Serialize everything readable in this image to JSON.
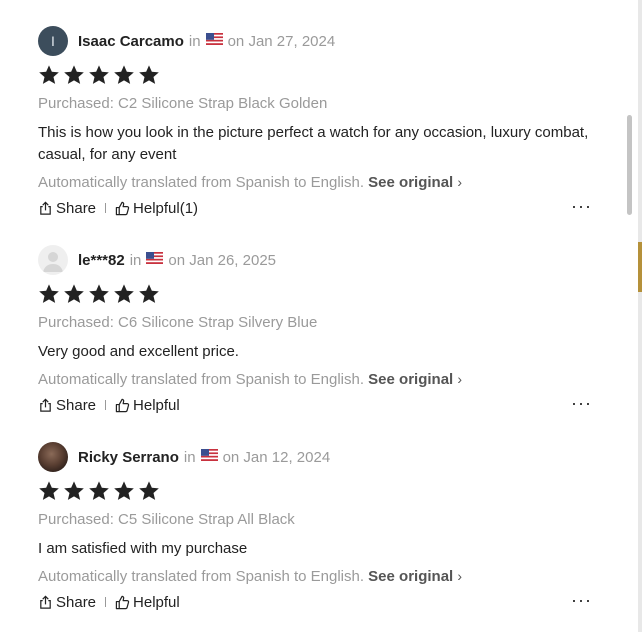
{
  "reviews": [
    {
      "avatar_letter": "I",
      "avatar_type": "letter",
      "name": "Isaac Carcamo",
      "in_label": "in",
      "date": "on Jan 27, 2024",
      "country_flag": "us-flag-icon",
      "rating": 5,
      "purchased": "Purchased: C2 Silicone Strap Black Golden",
      "text": "This is how you look in the picture perfect a watch for any occasion, luxury combat, casual, for any event",
      "translated_note": "Automatically translated from Spanish to English.",
      "see_original": "See original",
      "share": "Share",
      "helpful": "Helpful(1)"
    },
    {
      "avatar_letter": "",
      "avatar_type": "generic",
      "name": "le***82",
      "in_label": "in",
      "date": "on Jan 26, 2025",
      "country_flag": "us-flag-icon",
      "rating": 5,
      "purchased": "Purchased: C6 Silicone Strap Silvery Blue",
      "text": "Very good and excellent price.",
      "translated_note": "Automatically translated from Spanish to English.",
      "see_original": "See original",
      "share": "Share",
      "helpful": "Helpful"
    },
    {
      "avatar_letter": "",
      "avatar_type": "photo",
      "name": "Ricky Serrano",
      "in_label": "in",
      "date": "on Jan 12, 2024",
      "country_flag": "us-flag-icon",
      "rating": 5,
      "purchased": "Purchased: C5 Silicone Strap All Black",
      "text": "I am satisfied with my purchase",
      "translated_note": "Automatically translated from Spanish to English.",
      "see_original": "See original",
      "share": "Share",
      "helpful": "Helpful"
    }
  ],
  "colors": {
    "star": "#222222",
    "muted_text": "#9a9a9a",
    "avatar_letter_bg": "#3c4d5c"
  }
}
